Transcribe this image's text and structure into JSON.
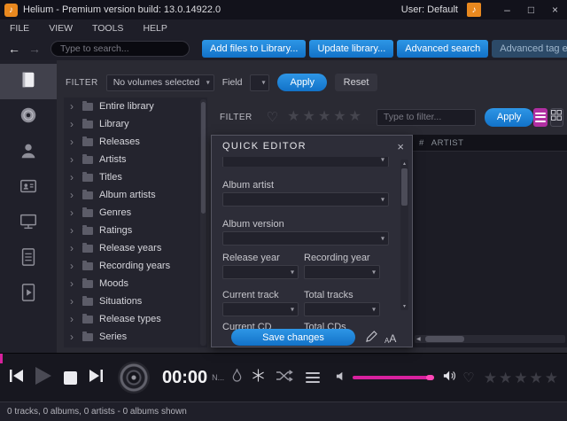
{
  "window": {
    "title": "Helium - Premium version build: 13.0.14922.0",
    "user": "User: Default",
    "app_icon_glyph": "♪",
    "minimize": "–",
    "maximize": "□",
    "close": "×"
  },
  "menu": {
    "items": [
      "FILE",
      "VIEW",
      "TOOLS",
      "HELP"
    ]
  },
  "toolbar": {
    "back": "←",
    "forward": "→",
    "search_placeholder": "Type to search...",
    "buttons": [
      {
        "label": "Add files to Library...",
        "enabled": true
      },
      {
        "label": "Update library...",
        "enabled": true
      },
      {
        "label": "Advanced search",
        "enabled": true
      },
      {
        "label": "Advanced tag edite",
        "enabled": false
      }
    ]
  },
  "sidebar": {
    "items": [
      "library",
      "discs",
      "artists",
      "contacts",
      "display",
      "playlists",
      "play-queue"
    ],
    "selected": "library"
  },
  "volume_filter": {
    "label": "FILTER",
    "volumes": "No volumes selected",
    "field": "Field",
    "apply": "Apply",
    "reset": "Reset"
  },
  "tree": {
    "items": [
      "Entire library",
      "Library",
      "Releases",
      "Artists",
      "Titles",
      "Album artists",
      "Genres",
      "Ratings",
      "Release years",
      "Recording years",
      "Moods",
      "Situations",
      "Release types",
      "Series"
    ]
  },
  "browser_filter": {
    "label": "FILTER",
    "placeholder": "Type to filter...",
    "apply": "Apply"
  },
  "quick_editor": {
    "title": "QUICK EDITOR",
    "close": "×",
    "album_artist": "Album artist",
    "album_version": "Album version",
    "release_year": "Release year",
    "recording_year": "Recording year",
    "current_track": "Current track",
    "total_tracks": "Total tracks",
    "current_cd": "Current CD",
    "total_cds": "Total CDs",
    "save": "Save changes",
    "font_small": "A",
    "font_large": "A"
  },
  "table": {
    "col_number": "#",
    "col_artist": "ARTIST"
  },
  "player": {
    "time": "00:00",
    "next_hint": "N..."
  },
  "status": {
    "text": "0 tracks, 0 albums, 0 artists - 0 albums shown"
  },
  "icons": {
    "star": "★",
    "heart": "♡",
    "dropdown": "▾",
    "chevron": "›",
    "scroll_up": "▴",
    "scroll_down": "▾",
    "scroll_left": "◀"
  },
  "colors": {
    "accent_blue": "#1b82d9",
    "accent_magenta": "#b02fa2",
    "slider_pink": "#d8219e",
    "brand_orange": "#e8881f"
  }
}
